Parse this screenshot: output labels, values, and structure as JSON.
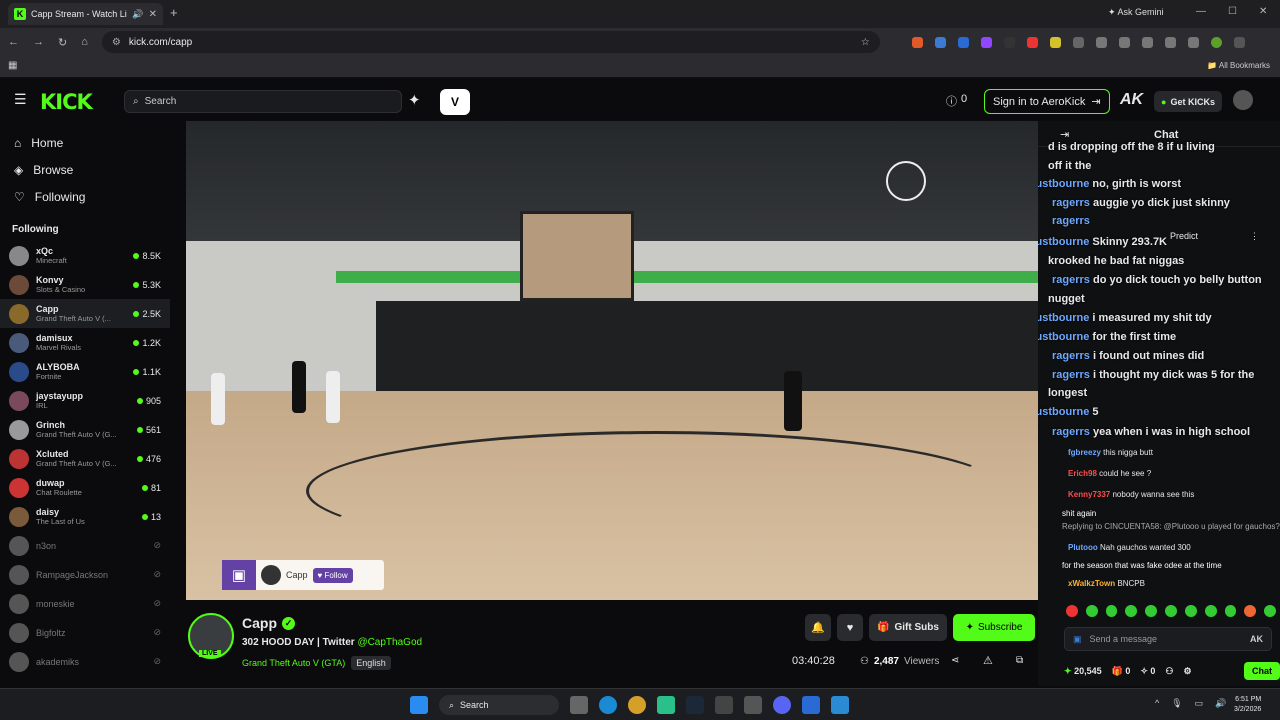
{
  "browser": {
    "tab_title": "Capp Stream - Watch Live ...",
    "tab_favicon": "K",
    "url": "kick.com/capp",
    "ask_gemini": "Ask Gemini",
    "all_bookmarks": "All Bookmarks"
  },
  "header": {
    "logo": "KICK",
    "search_placeholder": "Search",
    "notifications_count": "0",
    "sign_in_label": "Sign in to AeroKick",
    "ak_label": "AK",
    "get_kicks_label": "Get KICKs"
  },
  "sidebar": {
    "nav": [
      {
        "label": "Home",
        "icon": "home-icon"
      },
      {
        "label": "Browse",
        "icon": "compass-icon"
      },
      {
        "label": "Following",
        "icon": "heart-icon"
      }
    ],
    "following_heading": "Following",
    "channels": [
      {
        "name": "xQc",
        "game": "Minecraft",
        "viewers": "8.5K",
        "live": true,
        "color": "#888"
      },
      {
        "name": "Konvy",
        "game": "Slots & Casino",
        "viewers": "5.3K",
        "live": true,
        "color": "#6b4a3a"
      },
      {
        "name": "Capp",
        "game": "Grand Theft Auto V (...",
        "viewers": "2.5K",
        "live": true,
        "color": "#8a6a2a"
      },
      {
        "name": "damisux",
        "game": "Marvel Rivals",
        "viewers": "1.2K",
        "live": true,
        "color": "#4a5a7a"
      },
      {
        "name": "ALYBOBA",
        "game": "Fortnite",
        "viewers": "1.1K",
        "live": true,
        "color": "#2a4a8a"
      },
      {
        "name": "jaystayupp",
        "game": "IRL",
        "viewers": "905",
        "live": true,
        "color": "#7a4a5a"
      },
      {
        "name": "Grinch",
        "game": "Grand Theft Auto V (G...",
        "viewers": "561",
        "live": true,
        "color": "#999"
      },
      {
        "name": "Xcluted",
        "game": "Grand Theft Auto V (G...",
        "viewers": "476",
        "live": true,
        "color": "#b33"
      },
      {
        "name": "duwap",
        "game": "Chat Roulette",
        "viewers": "81",
        "live": true,
        "color": "#c33"
      },
      {
        "name": "daisy",
        "game": "The Last of Us",
        "viewers": "13",
        "live": true,
        "color": "#7a5a3a"
      },
      {
        "name": "n3on",
        "game": "",
        "viewers": "",
        "live": false,
        "color": "#555"
      },
      {
        "name": "RampageJackson",
        "game": "",
        "viewers": "",
        "live": false,
        "color": "#555"
      },
      {
        "name": "moneskie",
        "game": "",
        "viewers": "",
        "live": false,
        "color": "#555"
      },
      {
        "name": "Bigfoltz",
        "game": "",
        "viewers": "",
        "live": false,
        "color": "#555"
      },
      {
        "name": "akademiks",
        "game": "",
        "viewers": "",
        "live": false,
        "color": "#555"
      }
    ]
  },
  "video_overlay": {
    "streamer": "Capp",
    "follow_label": "Follow"
  },
  "stream": {
    "name": "Capp",
    "live_badge": "LIVE",
    "title_prefix": "302 HOOD DAY | Twitter",
    "twitter": "@CapThaGod",
    "category": "Grand Theft Auto V (GTA)",
    "language": "English",
    "gift_subs": "Gift Subs",
    "subscribe": "Subscribe",
    "uptime": "03:40:28",
    "viewers": "2,487",
    "viewers_label": "Viewers"
  },
  "chat": {
    "title": "Chat",
    "predict": "Predict",
    "big_messages": [
      {
        "user": "",
        "text": "d is dropping off the 8 if u living"
      },
      {
        "user": "",
        "text": "off it the"
      },
      {
        "user": "augustbourne",
        "text": "no, girth is worst"
      },
      {
        "user": "ragerrs",
        "text": "auggie yo dick just skinny"
      },
      {
        "user": "ragerrs",
        "text": ""
      },
      {
        "user": "augustbourne",
        "text": "Skinny 293.7K"
      },
      {
        "user": "",
        "text": "krooked he bad fat niggas"
      },
      {
        "user": "ragerrs",
        "text": "do yo dick touch yo belly button"
      },
      {
        "user": "",
        "text": "nugget"
      },
      {
        "user": "augustbourne",
        "text": "i measured my shit tdy"
      },
      {
        "user": "augustbourne",
        "text": "for the first time"
      },
      {
        "user": "ragerrs",
        "text": "i found out mines did"
      },
      {
        "user": "ragerrs",
        "text": "i thought my dick was 5 for the"
      },
      {
        "user": "",
        "text": "longest"
      },
      {
        "user": "augustbourne",
        "text": "5"
      },
      {
        "user": "ragerrs",
        "text": "yea when i was in high school"
      }
    ],
    "small_messages": [
      {
        "user": "fgbreezy",
        "text": "this nigga butt",
        "color": "#6da8ff"
      },
      {
        "user": "Erich98",
        "text": "could he see ?",
        "color": "#ff4d4d"
      },
      {
        "user": "Kenny7337",
        "text": "nobody wanna see this",
        "color": "#ff4d4d"
      },
      {
        "user": "",
        "text": "shit again",
        "color": "#fff"
      },
      {
        "user": "",
        "text": "Replying to CINCUENTA58: @Plutooo u played for gauchos?",
        "color": "#aaa"
      },
      {
        "user": "Plutooo",
        "text": "Nah gauchos wanted 300",
        "color": "#6da8ff"
      },
      {
        "user": "",
        "text": "for the season that was fake odee at the time",
        "color": "#fff"
      },
      {
        "user": "xWalkzTown",
        "text": "BNCPB",
        "color": "#ffb030"
      }
    ],
    "input_placeholder": "Send a message",
    "kicks_balance": "20,545",
    "gift_count": "0",
    "points": "0",
    "chat_button": "Chat"
  },
  "taskbar": {
    "search": "Search",
    "time": "6:51 PM",
    "date": "3/2/2026"
  },
  "colors": {
    "accent": "#53fc18",
    "background": "#0b0b0d",
    "twitch": "#6441a5"
  }
}
